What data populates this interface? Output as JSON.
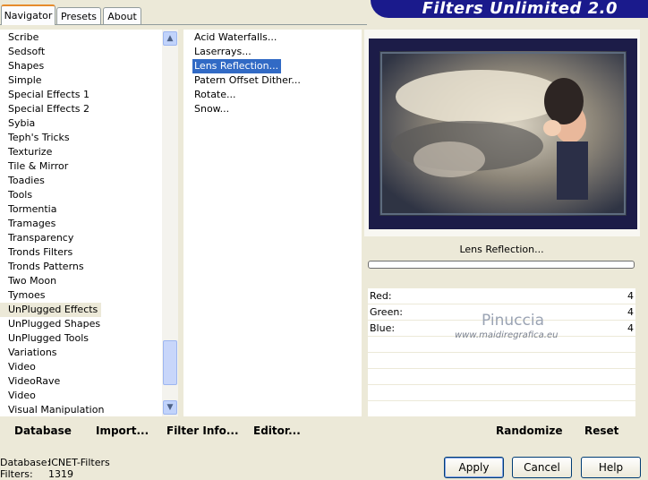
{
  "tabs": [
    "Navigator",
    "Presets",
    "About"
  ],
  "banner_title": "Filters Unlimited 2.0",
  "categories": [
    "Scribe",
    "Sedsoft",
    "Shapes",
    "Simple",
    "Special Effects 1",
    "Special Effects 2",
    "Sybia",
    "Teph's Tricks",
    "Texturize",
    "Tile & Mirror",
    "Toadies",
    "Tools",
    "Tormentia",
    "Tramages",
    "Transparency",
    "Tronds Filters",
    "Tronds Patterns",
    "Two Moon",
    "Tymoes",
    "UnPlugged Effects",
    "UnPlugged Shapes",
    "UnPlugged Tools",
    "Variations",
    "Video",
    "VideoRave",
    "Video",
    "Visual Manipulation"
  ],
  "selected_category": "UnPlugged Effects",
  "filters": [
    "Acid Waterfalls...",
    "Laserrays...",
    "Lens Reflection...",
    "Patern Offset Dither...",
    "Rotate...",
    "Snow..."
  ],
  "selected_filter": "Lens Reflection...",
  "filter_name": "Lens Reflection...",
  "params": [
    {
      "label": "Red:",
      "value": "4"
    },
    {
      "label": "Green:",
      "value": "4"
    },
    {
      "label": "Blue:",
      "value": "4"
    }
  ],
  "watermark": {
    "name": "Pinuccia",
    "url": "www.maidiregrafica.eu"
  },
  "bottom_links": {
    "database": "Database",
    "import": "Import...",
    "filter_info": "Filter Info...",
    "editor": "Editor...",
    "randomize": "Randomize",
    "reset": "Reset"
  },
  "status": {
    "database_label": "Database:",
    "database_value": "ICNET-Filters",
    "filters_label": "Filters:",
    "filters_value": "1319"
  },
  "buttons": {
    "apply": "Apply",
    "cancel": "Cancel",
    "help": "Help"
  },
  "colors": {
    "selection": "#316ac5",
    "banner": "#1a1a8c",
    "frame": "#1c1c48"
  }
}
